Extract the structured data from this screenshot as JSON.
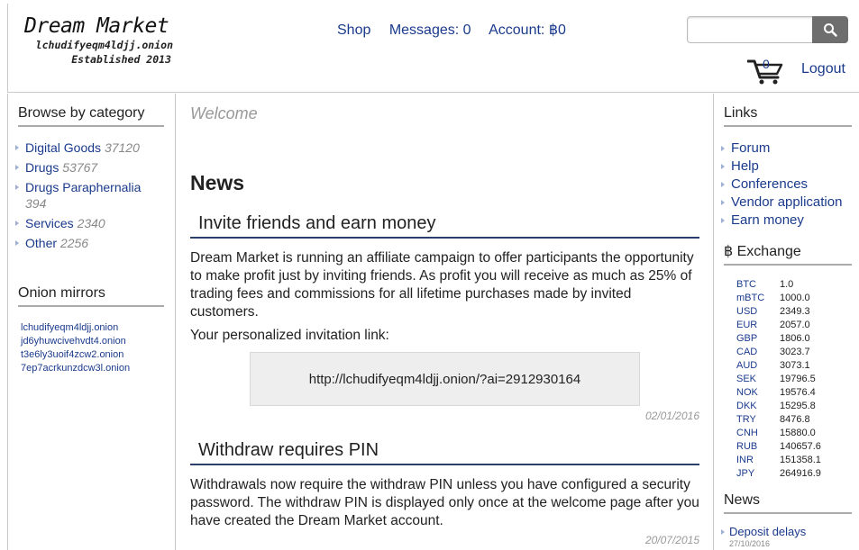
{
  "header": {
    "logo_title": "Dream Market",
    "logo_onion": "lchudifyeqm4ldjj.onion",
    "logo_established": "Established 2013",
    "nav": {
      "shop": "Shop",
      "messages": "Messages: 0",
      "account": "Account: ฿0"
    },
    "search": {
      "placeholder": "",
      "value": ""
    },
    "cart_count": "0",
    "logout": "Logout",
    "icons": {
      "search": "search-icon",
      "cart": "cart-icon"
    }
  },
  "left": {
    "browse_heading": "Browse by category",
    "categories": [
      {
        "label": "Digital Goods",
        "count": "37120"
      },
      {
        "label": "Drugs",
        "count": "53767"
      },
      {
        "label": "Drugs Paraphernalia",
        "count": "394"
      },
      {
        "label": "Services",
        "count": "2340"
      },
      {
        "label": "Other",
        "count": "2256"
      }
    ],
    "mirrors_heading": "Onion mirrors",
    "mirrors": [
      "lchudifyeqm4ldjj.onion",
      "jd6yhuwcivehvdt4.onion",
      "t3e6ly3uoif4zcw2.onion",
      "7ep7acrkunzdcw3l.onion"
    ]
  },
  "center": {
    "welcome": "Welcome",
    "news_heading": "News",
    "articles": [
      {
        "title": "Invite friends and earn money",
        "body": "Dream Market is running an affiliate campaign to offer participants the opportunity to make profit just by inviting friends. As profit you will receive as much as 25% of trading fees and commissions for all lifetime purchases made by invited customers.",
        "link_label": "Your personalized invitation link:",
        "link": "http://lchudifyeqm4ldjj.onion/?ai=2912930164",
        "date": "02/01/2016"
      },
      {
        "title": "Withdraw requires PIN",
        "body": "Withdrawals now require the withdraw PIN unless you have configured a security password. The withdraw PIN is displayed only once at the welcome page after you have created the Dream Market account.",
        "date": "20/07/2015"
      }
    ]
  },
  "right": {
    "links_heading": "Links",
    "links": [
      "Forum",
      "Help",
      "Conferences",
      "Vendor application",
      "Earn money"
    ],
    "exchange_heading": "฿ Exchange",
    "exchange": [
      {
        "cur": "BTC",
        "rate": "1.0"
      },
      {
        "cur": "mBTC",
        "rate": "1000.0"
      },
      {
        "cur": "USD",
        "rate": "2349.3"
      },
      {
        "cur": "EUR",
        "rate": "2057.0"
      },
      {
        "cur": "GBP",
        "rate": "1806.0"
      },
      {
        "cur": "CAD",
        "rate": "3023.7"
      },
      {
        "cur": "AUD",
        "rate": "3073.1"
      },
      {
        "cur": "SEK",
        "rate": "19796.5"
      },
      {
        "cur": "NOK",
        "rate": "19576.4"
      },
      {
        "cur": "DKK",
        "rate": "15295.8"
      },
      {
        "cur": "TRY",
        "rate": "8476.8"
      },
      {
        "cur": "CNH",
        "rate": "15880.0"
      },
      {
        "cur": "RUB",
        "rate": "140657.6"
      },
      {
        "cur": "INR",
        "rate": "151358.1"
      },
      {
        "cur": "JPY",
        "rate": "264916.9"
      }
    ],
    "news_heading": "News",
    "news": [
      {
        "title": "Deposit delays",
        "date": "27/10/2016"
      }
    ]
  }
}
